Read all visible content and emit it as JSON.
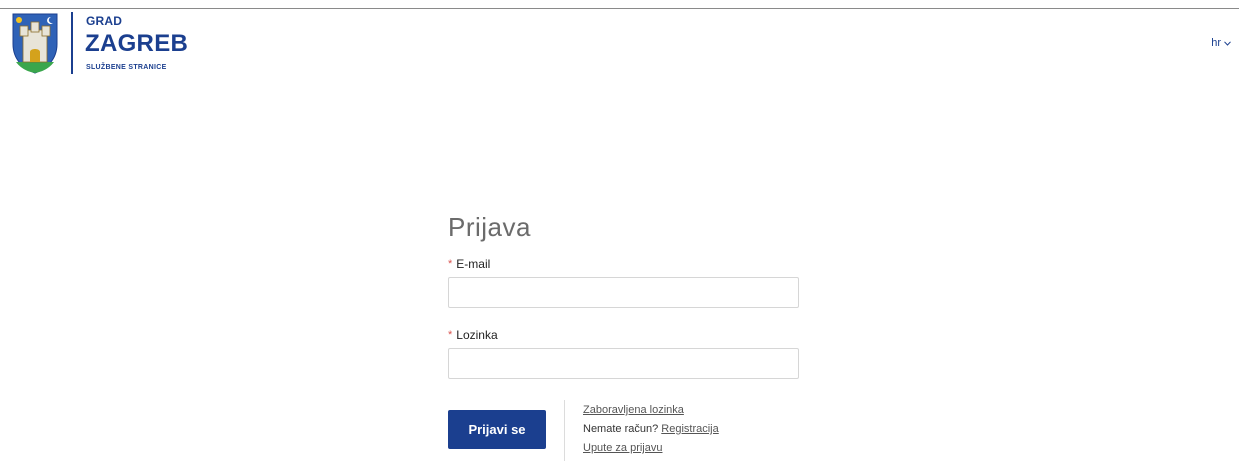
{
  "header": {
    "brand_line1": "GRAD",
    "brand_line2": "ZAGREB",
    "brand_line3": "SLUŽBENE STRANICE",
    "language": "hr"
  },
  "login": {
    "title": "Prijava",
    "email": {
      "label": "E-mail",
      "required_mark": "*",
      "value": "",
      "placeholder": ""
    },
    "password": {
      "label": "Lozinka",
      "required_mark": "*",
      "value": "",
      "placeholder": ""
    },
    "submit_label": "Prijavi se",
    "forgot_password": "Zaboravljena lozinka",
    "no_account_text": "Nemate račun?",
    "register_link": "Registracija",
    "instructions_link": "Upute za prijavu"
  },
  "colors": {
    "brand_blue": "#1b3f8f",
    "required_red": "#d9534f",
    "title_gray": "#6b6b6b"
  }
}
